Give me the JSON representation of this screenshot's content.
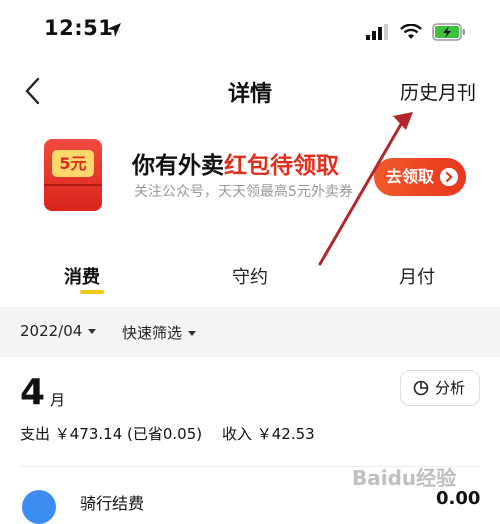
{
  "status_bar": {
    "time": "12:51"
  },
  "nav": {
    "title": "详情",
    "history_link": "历史月刊"
  },
  "banner": {
    "badge": "5元",
    "title_part1": "你有外卖",
    "title_part2": "红包待领取",
    "subtitle": "关注公众号，天天领最高5元外卖券",
    "claim_button": "去领取"
  },
  "tabs": [
    {
      "label": "消费",
      "active": true
    },
    {
      "label": "守约",
      "active": false
    },
    {
      "label": "月付",
      "active": false
    }
  ],
  "filter": {
    "date": "2022/04",
    "quick_filter": "快速筛选"
  },
  "summary": {
    "month": "4",
    "month_unit": "月",
    "expense": "支出 ￥473.14 (已省0.05)",
    "income": "收入 ￥42.53",
    "analyze_button": "分析"
  },
  "partial_row": {
    "title": "骑行结费",
    "amount": "0.00"
  },
  "colors": {
    "accent_red": "#e2301f",
    "tab_underline": "#f5c518",
    "annotation_arrow": "#b3262a"
  },
  "icons": [
    "location-arrow-icon",
    "signal-icon",
    "wifi-icon",
    "battery-charging-icon",
    "back-chevron-icon",
    "right-arrow-icon",
    "pie-chart-icon",
    "caret-down-icon"
  ],
  "watermark": "Baidu经验"
}
